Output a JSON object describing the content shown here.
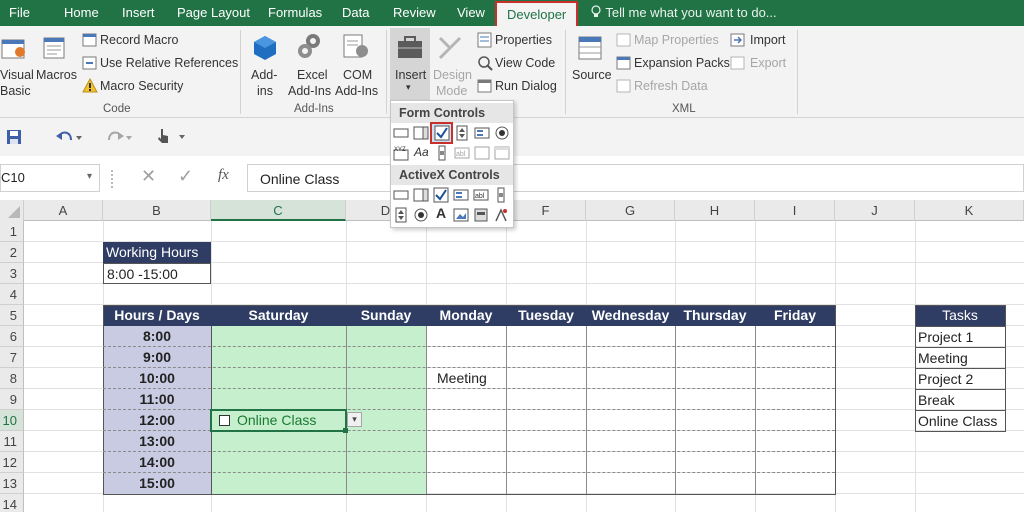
{
  "tabs": [
    "File",
    "Home",
    "Insert",
    "Page Layout",
    "Formulas",
    "Data",
    "Review",
    "View",
    "Developer"
  ],
  "tell_me": "Tell me what you want to do...",
  "ribbon": {
    "code": {
      "visual_basic_1": "Visual",
      "visual_basic_2": "Basic",
      "macros": "Macros",
      "record_macro": "Record Macro",
      "use_relative": "Use Relative References",
      "macro_security": "Macro Security",
      "label": "Code"
    },
    "addins": {
      "addins_1": "Add-",
      "addins_2": "ins",
      "excel_1": "Excel",
      "excel_2": "Add-Ins",
      "com_1": "COM",
      "com_2": "Add-Ins",
      "label": "Add-Ins"
    },
    "controls": {
      "insert": "Insert",
      "design_1": "Design",
      "design_2": "Mode",
      "properties": "Properties",
      "view_code": "View Code",
      "run_dialog": "Run Dialog"
    },
    "xml": {
      "source": "Source",
      "map_properties": "Map Properties",
      "expansion_packs": "Expansion Packs",
      "refresh_data": "Refresh Data",
      "import": "Import",
      "export": "Export",
      "label": "XML"
    }
  },
  "dropdown": {
    "form_controls": "Form Controls",
    "activex_controls": "ActiveX Controls"
  },
  "name_box": "C10",
  "formula_value": "Online Class",
  "fx_icon": "fx",
  "columns": [
    "A",
    "B",
    "C",
    "D",
    "E",
    "F",
    "G",
    "H",
    "I",
    "J",
    "K"
  ],
  "rows": [
    "1",
    "2",
    "3",
    "4",
    "5",
    "6",
    "7",
    "8",
    "9",
    "10",
    "11",
    "12",
    "13",
    "14"
  ],
  "sheet": {
    "working_hours_label": "Working Hours",
    "working_hours_value": "8:00 -15:00",
    "schedule_headers": [
      "Hours / Days",
      "Saturday",
      "Sunday",
      "Monday",
      "Tuesday",
      "Wednesday",
      "Thursday",
      "Friday"
    ],
    "hours": [
      "8:00",
      "9:00",
      "10:00",
      "11:00",
      "12:00",
      "13:00",
      "14:00",
      "15:00"
    ],
    "meeting_cell": "Meeting",
    "online_class_checkbox": "Online Class",
    "tasks_header": "Tasks",
    "tasks": [
      "Project 1",
      "Meeting",
      "Project 2",
      "Break",
      "Online Class"
    ]
  },
  "colors": {
    "excel_green": "#217346",
    "header_navy": "#2f3d64",
    "hours_fill": "#c9cbe2",
    "weekend_fill": "#c6efce",
    "highlight_red": "#c8302c"
  }
}
